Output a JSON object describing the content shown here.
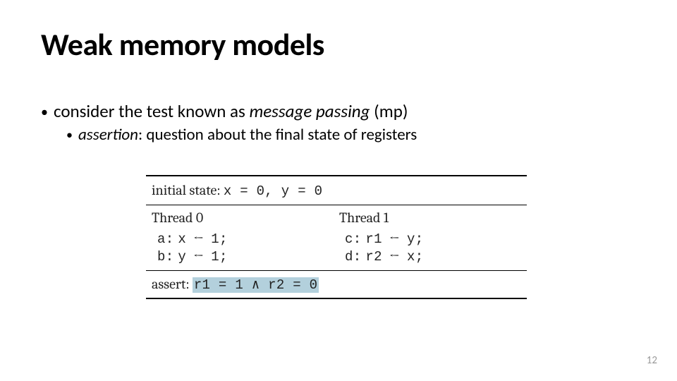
{
  "title": "Weak memory models",
  "bullet1": {
    "pre": "consider the test known as ",
    "em": "message passing",
    "post": " (mp)"
  },
  "bullet2": {
    "em": "assertion",
    "post": ": question about the final state of registers"
  },
  "table": {
    "initial_label": "initial state:",
    "initial_values": "x = 0, y = 0",
    "thread0": {
      "header": "Thread 0",
      "stmts": [
        {
          "lbl": "a:",
          "lhs": "x",
          "arrow": "←",
          "rhs": "1;"
        },
        {
          "lbl": "b:",
          "lhs": "y",
          "arrow": "←",
          "rhs": "1;"
        }
      ]
    },
    "thread1": {
      "header": "Thread 1",
      "stmts": [
        {
          "lbl": "c:",
          "lhs": "r1",
          "arrow": "←",
          "rhs": "y;"
        },
        {
          "lbl": "d:",
          "lhs": "r2",
          "arrow": "←",
          "rhs": "x;"
        }
      ]
    },
    "assert_label": "assert:",
    "assert_expr": "r1 = 1 ∧ r2 = 0"
  },
  "page_number": "12"
}
